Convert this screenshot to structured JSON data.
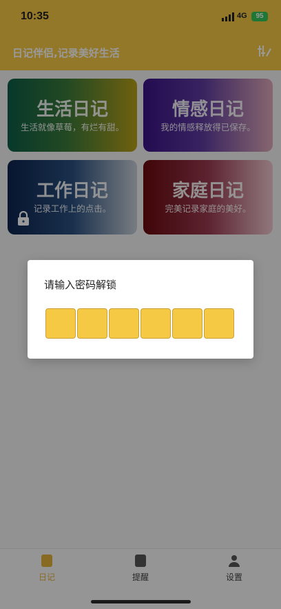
{
  "status_bar": {
    "time": "10:35",
    "network": "4G",
    "battery": "95"
  },
  "header": {
    "title": "日记伴侣,记录美好生活",
    "action_icon": "edit-sliders-icon"
  },
  "cards": [
    {
      "title": "生活日记",
      "subtitle": "生活就像草莓，有烂有甜。"
    },
    {
      "title": "情感日记",
      "subtitle": "我的情感释放得已保存。"
    },
    {
      "title": "工作日记",
      "subtitle": "记录工作上的点击。",
      "locked": true
    },
    {
      "title": "家庭日记",
      "subtitle": "完美记录家庭的美好。"
    }
  ],
  "dialog": {
    "title": "请输入密码解锁",
    "pin_length": 6
  },
  "tabbar": {
    "items": [
      {
        "label": "日记",
        "active": true,
        "icon": "diary-icon"
      },
      {
        "label": "提醒",
        "active": false,
        "icon": "reminder-icon"
      },
      {
        "label": "设置",
        "active": false,
        "icon": "settings-user-icon"
      }
    ]
  },
  "colors": {
    "accent": "#f6c945",
    "active_tab": "#e3b23a"
  }
}
